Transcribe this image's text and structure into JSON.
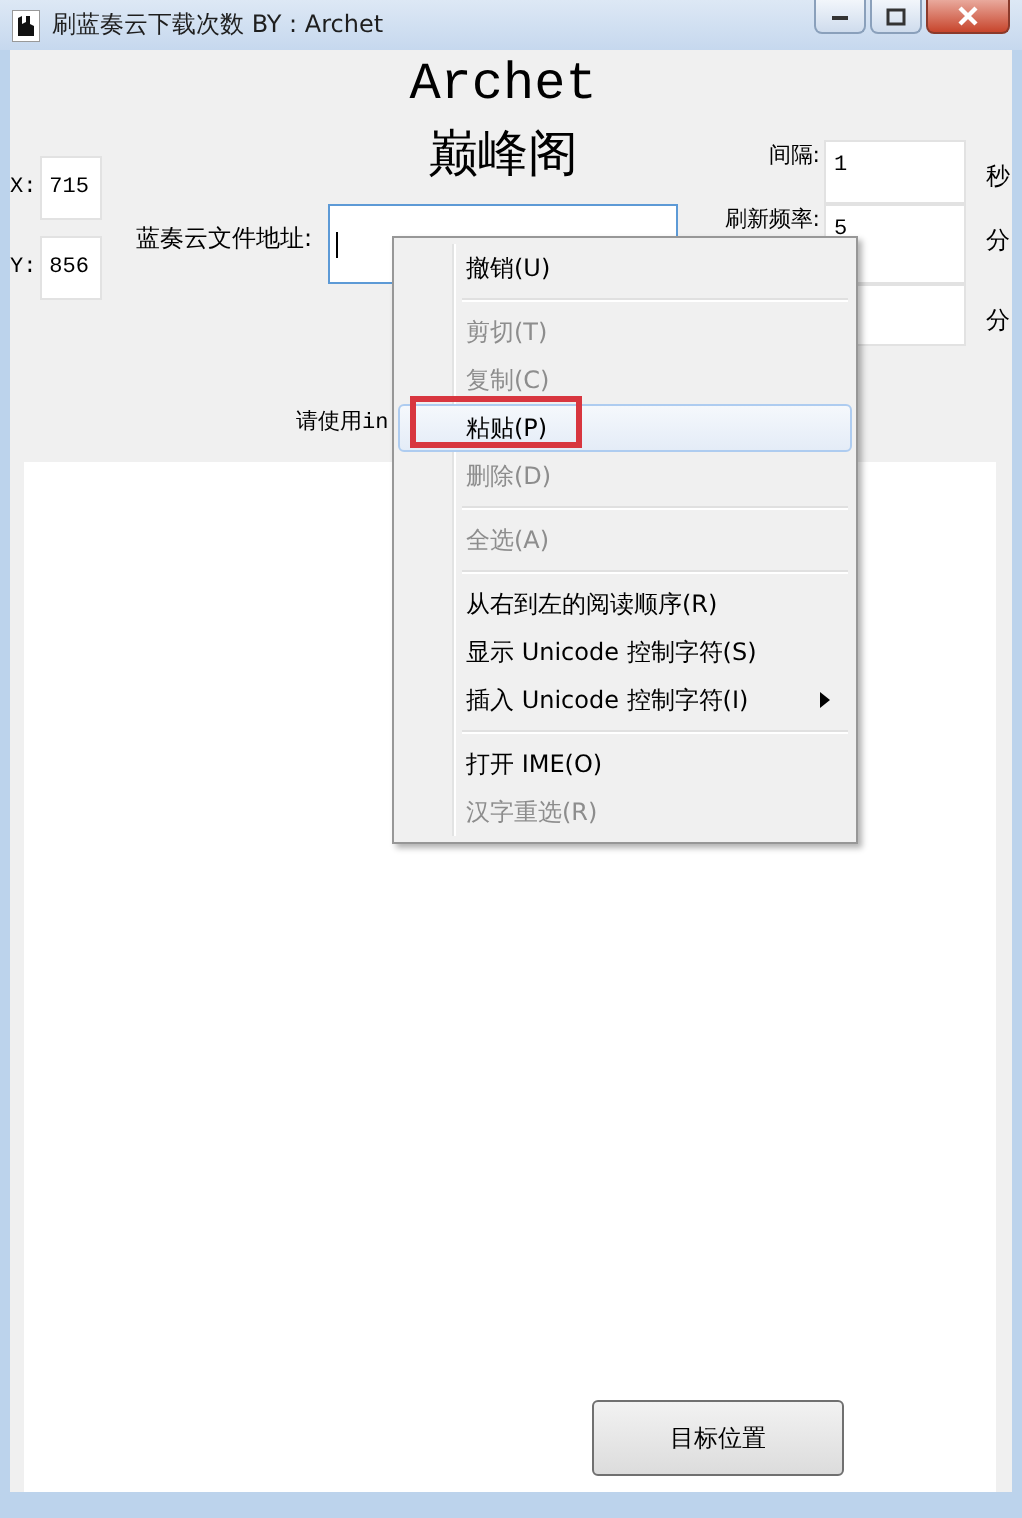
{
  "window": {
    "title": "刷蓝奏云下载次数 BY : Archet"
  },
  "header": {
    "title": "Archet",
    "subtitle": "巅峰阁"
  },
  "coords": [
    {
      "label": "X:",
      "value": "715"
    },
    {
      "label": "Y:",
      "value": "856"
    }
  ],
  "address": {
    "label": "蓝奏云文件地址:",
    "focused": true
  },
  "settings": [
    {
      "label": "间隔:",
      "value": "1",
      "unit": "秒"
    },
    {
      "label": "刷新频率:",
      "value": "5",
      "unit": "分"
    },
    {
      "unit": "分"
    }
  ],
  "hint": "请使用in",
  "button": "目标位置",
  "context_menu": [
    {
      "kind": "item",
      "label": "撤销(U)",
      "disabled": false,
      "selected": false,
      "submenu": false,
      "annotated": false
    },
    {
      "kind": "separator"
    },
    {
      "kind": "item",
      "label": "剪切(T)",
      "disabled": true,
      "selected": false,
      "submenu": false,
      "annotated": false
    },
    {
      "kind": "item",
      "label": "复制(C)",
      "disabled": true,
      "selected": false,
      "submenu": false,
      "annotated": false
    },
    {
      "kind": "item",
      "label": "粘贴(P)",
      "disabled": false,
      "selected": true,
      "submenu": false,
      "annotated": true
    },
    {
      "kind": "item",
      "label": "删除(D)",
      "disabled": true,
      "selected": false,
      "submenu": false,
      "annotated": false
    },
    {
      "kind": "separator"
    },
    {
      "kind": "item",
      "label": "全选(A)",
      "disabled": true,
      "selected": false,
      "submenu": false,
      "annotated": false
    },
    {
      "kind": "separator"
    },
    {
      "kind": "item",
      "label": "从右到左的阅读顺序(R)",
      "disabled": false,
      "selected": false,
      "submenu": false,
      "annotated": false
    },
    {
      "kind": "item",
      "label": "显示 Unicode 控制字符(S)",
      "disabled": false,
      "selected": false,
      "submenu": false,
      "annotated": false
    },
    {
      "kind": "item",
      "label": "插入 Unicode 控制字符(I)",
      "disabled": false,
      "selected": false,
      "submenu": true,
      "annotated": false
    },
    {
      "kind": "separator"
    },
    {
      "kind": "item",
      "label": "打开 IME(O)",
      "disabled": false,
      "selected": false,
      "submenu": false,
      "annotated": false
    },
    {
      "kind": "item",
      "label": "汉字重选(R)",
      "disabled": true,
      "selected": false,
      "submenu": false,
      "annotated": false
    }
  ]
}
